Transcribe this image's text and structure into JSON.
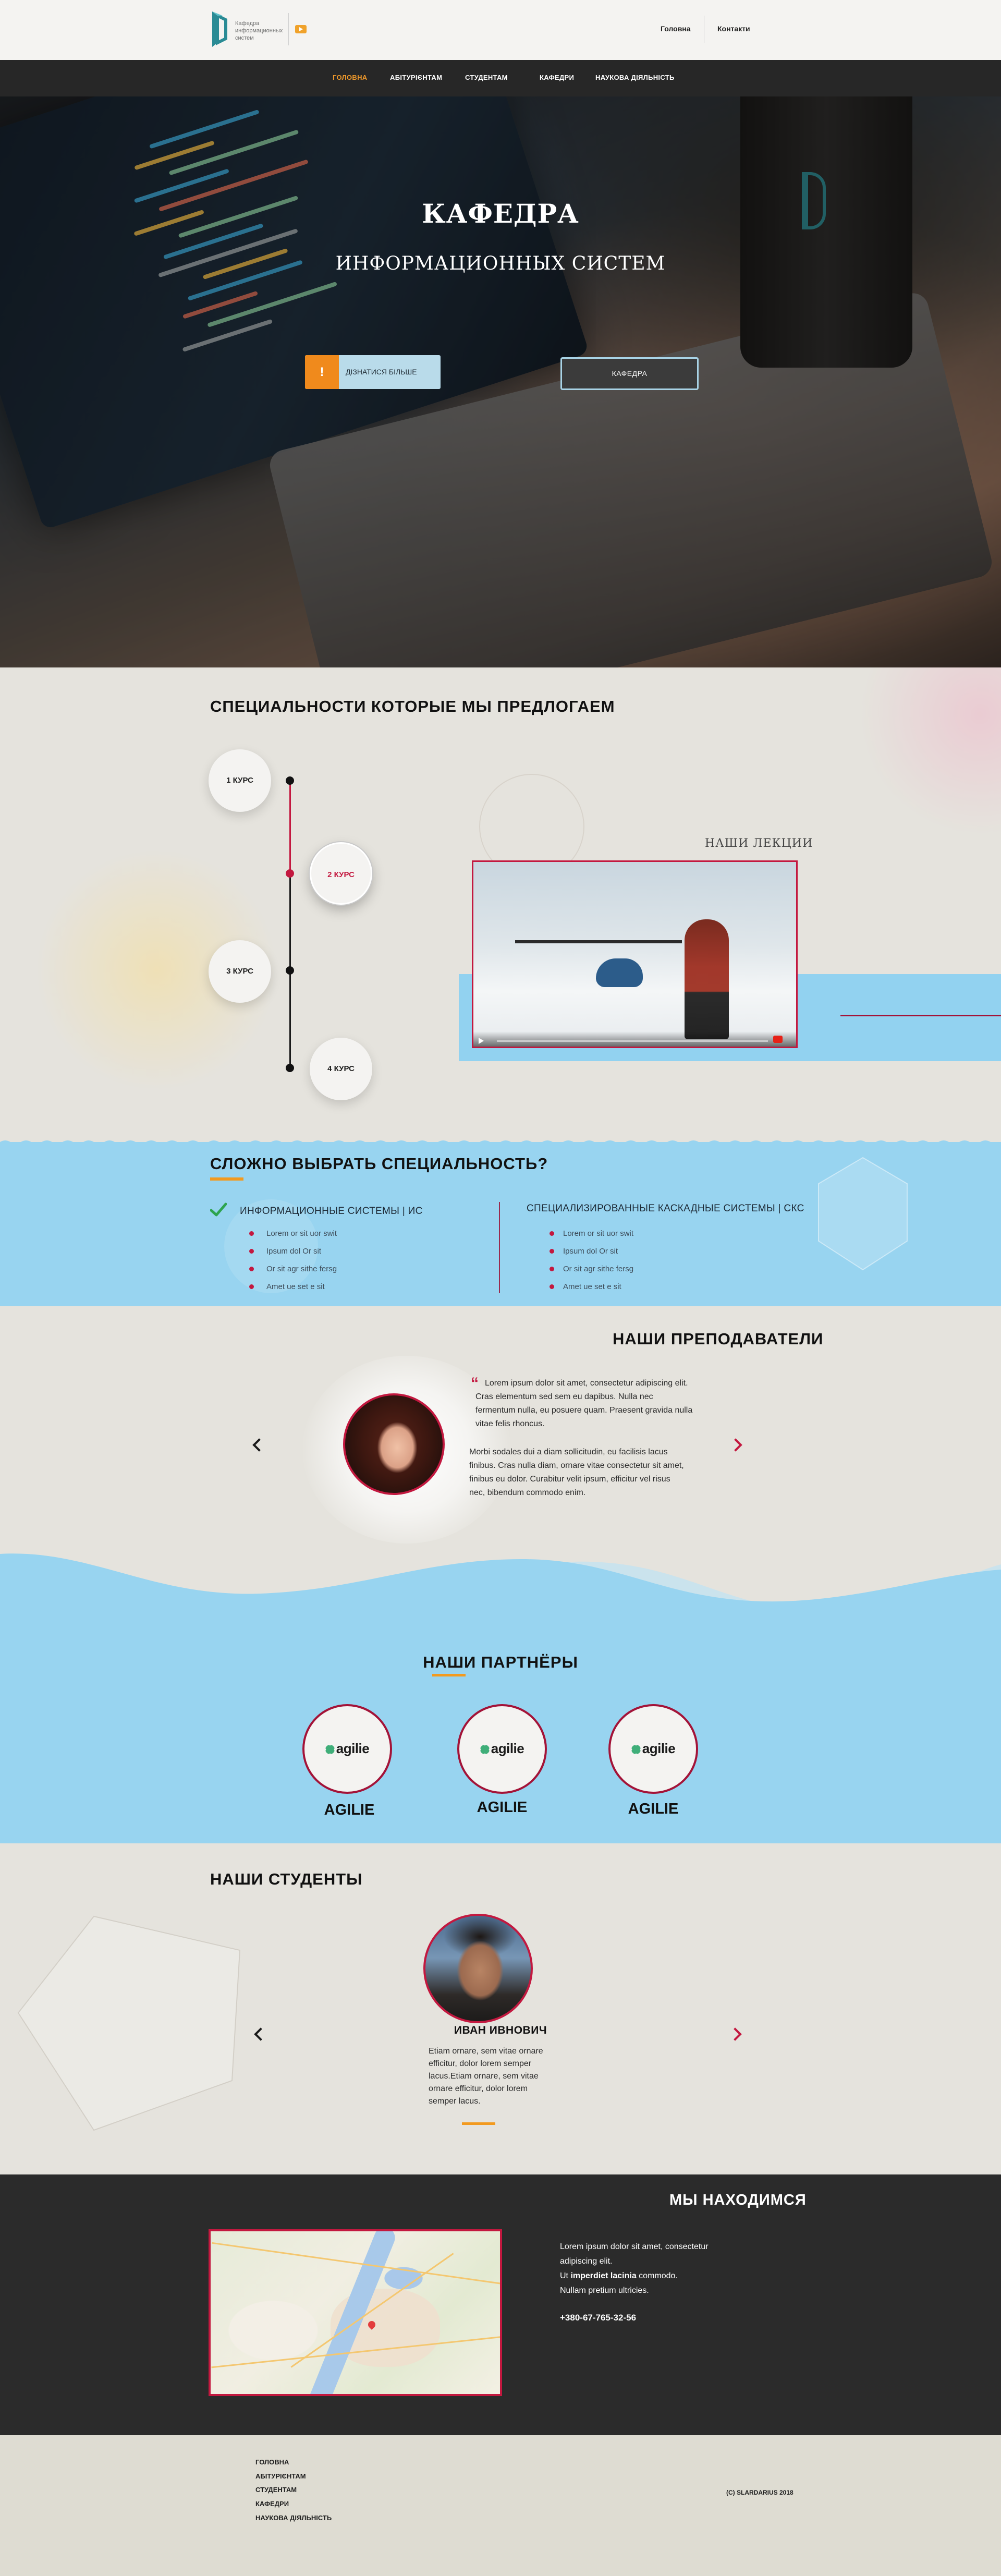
{
  "header": {
    "logo_text": "Кафедра информационных систем",
    "links": [
      "Головна",
      "Контакти"
    ]
  },
  "nav": {
    "items": [
      "ГОЛОВНА",
      "АБІТУРІЄНТАМ",
      "СТУДЕНТАМ",
      "КАФЕДРИ",
      "НАУКОВА ДІЯЛЬНІСТЬ"
    ],
    "active_index": 0
  },
  "hero": {
    "title_line1": "КАФЕДРА",
    "title_line2": "ИНФОРМАЦИОННЫХ СИСТЕМ",
    "learn_more_icon": "!",
    "learn_more_label": "ДІЗНАТИСЯ БІЛЬШЕ",
    "department_button": "КАФЕДРА"
  },
  "specialties": {
    "title": "СПЕЦИАЛЬНОСТИ КОТОРЫЕ МЫ ПРЕДЛОГАЕМ",
    "courses": [
      "1 КУРС",
      "2 КУРС",
      "3 КУРС",
      "4 КУРС"
    ],
    "active_course_index": 1,
    "lectures_label": "НАШИ ЛЕКЦИИ"
  },
  "choose": {
    "title": "СЛОЖНО ВЫБРАТЬ СПЕЦИАЛЬНОСТЬ?",
    "col1": {
      "heading": "ИНФОРМАЦИОННЫЕ СИСТЕМЫ | ИС",
      "items": [
        "Lorem or sit uor swit",
        "Ipsum dol Or sit",
        "Or sit agr sithe fersg",
        "Amet ue set e sit"
      ]
    },
    "col2": {
      "heading": "СПЕЦИАЛИЗИРОВАННЫЕ КАСКАДНЫЕ СИСТЕМЫ | СКС",
      "items": [
        "Lorem or sit uor swit",
        "Ipsum dol Or sit",
        "Or sit agr sithe fersg",
        "Amet ue set e sit"
      ]
    }
  },
  "teachers": {
    "title": "НАШИ ПРЕПОДАВАТЕЛИ",
    "quote_mark": "“",
    "paragraph1": "Lorem ipsum dolor sit amet, consectetur adipiscing elit. Cras elementum sed sem eu dapibus. Nulla nec fermentum nulla, eu posuere quam. Praesent gravida nulla vitae felis rhoncus.",
    "paragraph2": "Morbi sodales dui a diam sollicitudin, eu facilisis lacus finibus. Cras nulla diam, ornare vitae consectetur sit amet, finibus eu dolor. Curabitur velit ipsum, efficitur vel risus nec, bibendum commodo enim."
  },
  "partners": {
    "title": "НАШИ ПАРТНЁРЫ",
    "logo_text": "agilie",
    "items": [
      "AGILIE",
      "AGILIE",
      "AGILIE"
    ]
  },
  "students": {
    "title": "НАШИ СТУДЕНТЫ",
    "name": "ИВАН ИВНОВИЧ",
    "text": "Etiam ornare, sem vitae ornare efficitur, dolor lorem semper lacus.Etiam ornare, sem vitae ornare efficitur, dolor lorem semper lacus."
  },
  "location": {
    "title": "МЫ НАХОДИМСЯ",
    "line1": "Lorem ipsum dolor sit amet, consectetur adipiscing elit.",
    "line2_pre": "Ut ",
    "line2_bold": "imperdiet lacinia",
    "line2_post": " commodo.",
    "line3": "Nullam pretium ultricies.",
    "phone": "+380-67-765-32-56"
  },
  "footer": {
    "links": [
      "ГОЛОВНА",
      "АБІТУРІЄНТАМ",
      "СТУДЕНТАМ",
      "КАФЕДРИ",
      "НАУКОВА ДІЯЛЬНІСТЬ"
    ],
    "copyright": "(C) SLARDARIUS  2018"
  },
  "colors": {
    "accent_orange": "#f29a1f",
    "accent_crimson": "#c3183f",
    "light_blue": "#98d4f0",
    "dark": "#272727",
    "background": "#e5e3dd"
  }
}
